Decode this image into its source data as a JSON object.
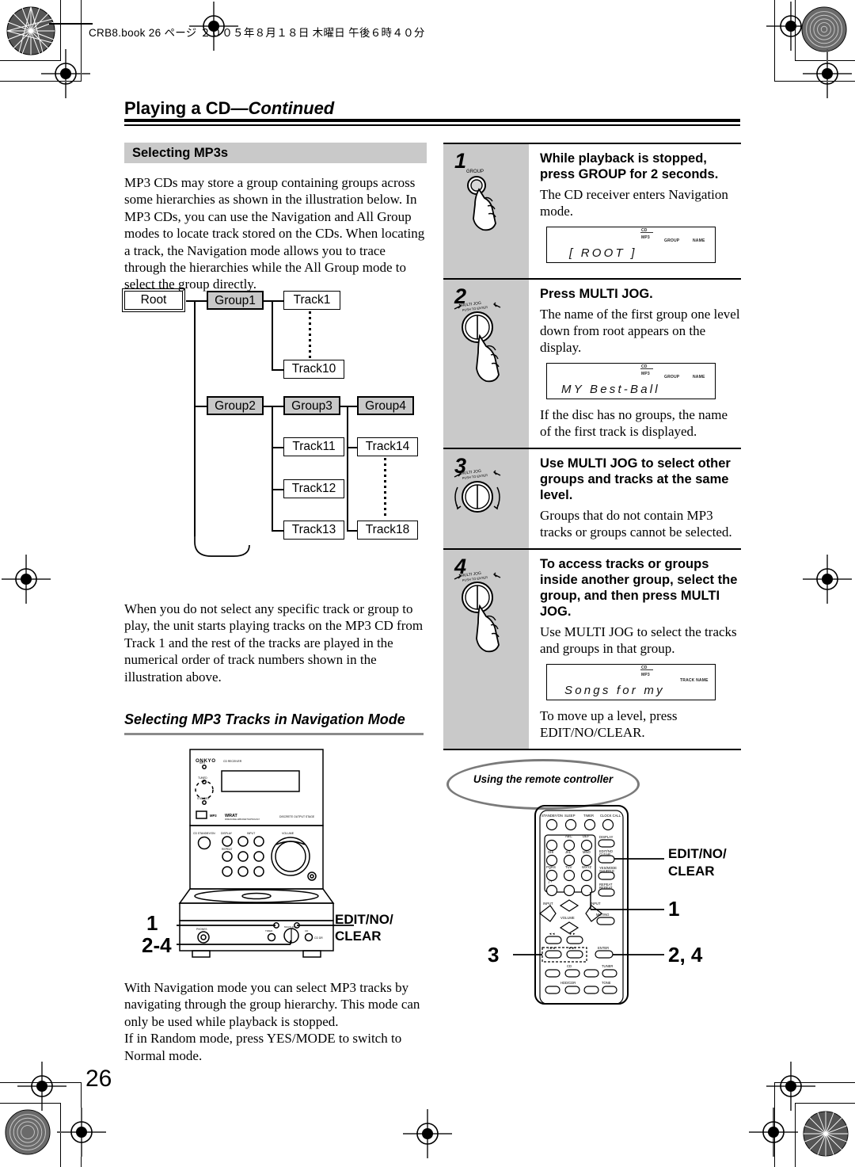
{
  "print_stamp": "CRB8.book  26 ページ  ２００５年８月１８日   木曜日   午後６時４０分",
  "chapter": {
    "title": "Playing a CD",
    "continued": "—Continued"
  },
  "page_number": "26",
  "left_column": {
    "section_heading": "Selecting MP3s",
    "intro_paragraph": "MP3 CDs may store a group containing groups across some hierarchies as shown in the illustration below. In MP3 CDs, you can use the Navigation and All Group modes to locate track stored on the CDs. When locating a track, the Navigation mode allows you to trace through the hierarchies while the All Group mode to select the group directly.",
    "after_diagram_paragraph": "When you do not select any specific track or group to play, the unit starts playing tracks on the MP3 CD from Track 1 and the rest of the tracks are played in the numerical order of track numbers shown in the illustration above.",
    "section_heading_2": "Selecting MP3 Tracks in Navigation Mode",
    "nav_paragraph_1": "With Navigation mode you can select MP3 tracks by navigating through the group hierarchy. This mode can only be used while playback is stopped.",
    "nav_paragraph_2": "If in Random mode, press YES/MODE to switch to Normal mode."
  },
  "diagram": {
    "root": "Root",
    "group1": "Group1",
    "group2": "Group2",
    "group3": "Group3",
    "group4": "Group4",
    "track1": "Track1",
    "track10": "Track10",
    "track11": "Track11",
    "track12": "Track12",
    "track13": "Track13",
    "track14": "Track14",
    "track18": "Track18"
  },
  "unit_illustration": {
    "brand": "ONKYO",
    "model": "CD RECEIVER",
    "leds": [
      "MP3",
      "TUNED",
      "STANDBY"
    ],
    "logos": [
      "CD",
      "MP3",
      "WRAT"
    ],
    "logo_sub": "WIDE RANGE AMPLIFIER TECHNOLOGY",
    "right_logo": "DISCRETE OUTPUT STAGE",
    "controls": [
      "CD STANDBY/ON",
      "DISPLAY",
      "INPUT",
      "REPEAT",
      "VOLUME",
      "PHONES",
      "TIMER",
      "CD/JOG"
    ],
    "callout_1": "1",
    "callout_2_4": "2-4",
    "callout_edit_line1": "EDIT/NO/",
    "callout_edit_line2": "CLEAR"
  },
  "steps": [
    {
      "number": "1",
      "icon": "group-button-press-icon",
      "icon_label": "GROUP",
      "title": "While playback is stopped, press GROUP for 2 seconds.",
      "text": [
        "The CD receiver enters Navigation mode."
      ],
      "display": {
        "indicators": [
          "CD",
          "MP3",
          "GROUP",
          "NAME"
        ],
        "text": "[ ROOT ]"
      }
    },
    {
      "number": "2",
      "icon": "multi-jog-press-icon",
      "icon_label": "MULTI JOG",
      "icon_sublabel": "PUSH TO ENTER",
      "title": "Press MULTI JOG.",
      "text": [
        "The name of the first group one level down from root appears on the display.",
        "If the disc has no groups, the name of the first track is displayed."
      ],
      "display": {
        "indicators": [
          "CD",
          "MP3",
          "GROUP",
          "NAME"
        ],
        "text": "MY Best-Ball"
      }
    },
    {
      "number": "3",
      "icon": "multi-jog-turn-icon",
      "icon_label": "MULTI JOG",
      "icon_sublabel": "PUSH TO ENTER",
      "title": "Use MULTI JOG to select other groups and tracks at the same level.",
      "text": [
        "Groups that do not contain MP3 tracks or groups cannot be selected."
      ],
      "display": null
    },
    {
      "number": "4",
      "icon": "multi-jog-press-icon",
      "icon_label": "MULTI JOG",
      "icon_sublabel": "PUSH TO ENTER",
      "title": "To access tracks or groups inside another group, select the group, and then press MULTI JOG.",
      "text": [
        "Use MULTI JOG to select the tracks and groups in that group.",
        "To move up a level, press EDIT/NO/CLEAR."
      ],
      "display": {
        "indicators": [
          "CD",
          "MP3",
          "TRACK NAME"
        ],
        "text": "Songs for my"
      }
    }
  ],
  "remote": {
    "bubble_label": "Using the remote controller",
    "buttons_top": [
      "STANDBY/ON",
      "SLEEP",
      "TIMER",
      "CLOCK CALL"
    ],
    "keypad_labels": [
      "ABC",
      "DEF",
      "GHI",
      "JKL",
      "MNO",
      "PQRS",
      "TUV",
      "WXYZ"
    ],
    "right_buttons": [
      "DISPLAY",
      "EDIT/NO CLEAR",
      "YES/MODE SHUFFLE",
      "REPEAT"
    ],
    "nav_labels": [
      "INPUT",
      "VOLUME",
      "INPUT",
      "MUTING",
      "ENTER",
      "TUNER",
      "TONE"
    ],
    "deck_labels": [
      "CD",
      "HDD/CDR"
    ],
    "callout_edit_line1": "EDIT/NO/",
    "callout_edit_line2": "CLEAR",
    "callout_1": "1",
    "callout_3": "3",
    "callout_2_4": "2, 4"
  },
  "colors": {
    "grey_panel": "#c9c9c9",
    "rule_grey": "#8a8a8a",
    "ink": "#000000"
  }
}
